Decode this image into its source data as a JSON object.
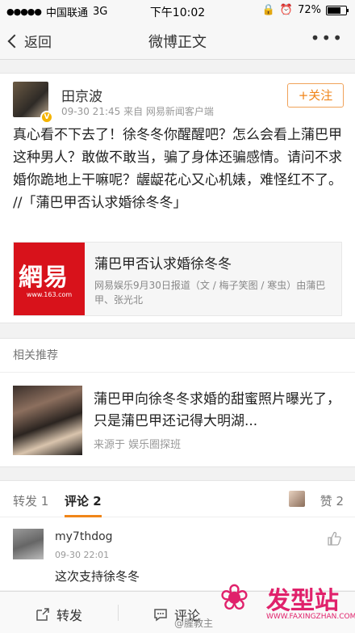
{
  "status_bar": {
    "carrier": "中国联通",
    "network": "3G",
    "time": "下午10:02",
    "battery_percent_label": "72%",
    "battery_level": 0.72
  },
  "nav": {
    "back_label": "返回",
    "title": "微博正文",
    "more_label": "•••"
  },
  "post": {
    "author": "田京波",
    "verified_badge": "V",
    "time": "09-30 21:45",
    "source": "来自 网易新闻客户端",
    "follow_label": "+关注",
    "text": "真心看不下去了！徐冬冬你醒醒吧？怎么会看上蒲巴甲这种男人？敢做不敢当，骗了身体还骗感情。请问不求婚你跪地上干嘛呢？龌龊花心又心机婊，难怪红不了。 //「蒲巴甲否认求婚徐冬冬」",
    "card": {
      "logo_text": "網易",
      "logo_url": "www.163.com",
      "title": "蒲巴甲否认求婚徐冬冬",
      "desc": "网易娱乐9月30日报道（文 / 梅子笑图 / 寒虫）由蒲巴甲、张光北"
    }
  },
  "related": {
    "header": "相关推荐",
    "title": "蒲巴甲向徐冬冬求婚的甜蜜照片曝光了，只是蒲巴甲还记得大明湖...",
    "source": "来源于 娱乐圈探班"
  },
  "tabs": {
    "repost": "转发 1",
    "comments": "评论 2",
    "likes": "赞 2"
  },
  "comment": {
    "user": "my7thdog",
    "time": "09-30 22:01",
    "text": "这次支持徐冬冬"
  },
  "toolbar": {
    "repost": "转发",
    "comment": "评论"
  },
  "watermark": {
    "brand": "发型站",
    "url": "WWW.FAXINGZHAN.COM",
    "weibo_handle": "@腥教主"
  },
  "colors": {
    "accent": "#f08519",
    "netease_red": "#d8121b",
    "watermark_pink": "#e0216b"
  }
}
